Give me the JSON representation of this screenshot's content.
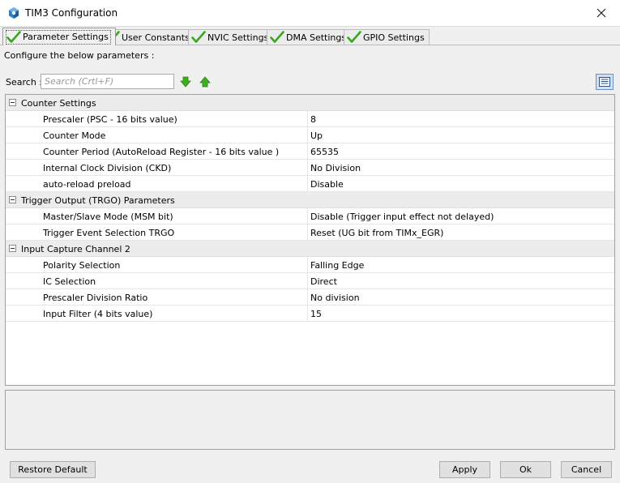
{
  "window": {
    "title": "TIM3 Configuration",
    "close_icon": "close-icon",
    "app_icon": "mx-cube-icon"
  },
  "tabs": [
    {
      "label": "Parameter Settings",
      "active": true,
      "icon": "green-check-icon"
    },
    {
      "label": "User Constants",
      "active": false,
      "icon": "green-check-icon"
    },
    {
      "label": "NVIC Settings",
      "active": false,
      "icon": "green-check-icon"
    },
    {
      "label": "DMA Settings",
      "active": false,
      "icon": "green-check-icon"
    },
    {
      "label": "GPIO Settings",
      "active": false,
      "icon": "green-check-icon"
    }
  ],
  "subtitle": "Configure the below parameters :",
  "search": {
    "label": "Search :",
    "placeholder": "Search (Crtl+F)",
    "value": ""
  },
  "groups": [
    {
      "label": "Counter Settings",
      "params": [
        {
          "name": "Prescaler (PSC - 16 bits value)",
          "value": "8"
        },
        {
          "name": "Counter Mode",
          "value": "Up"
        },
        {
          "name": "Counter Period (AutoReload Register - 16 bits value )",
          "value": "65535"
        },
        {
          "name": "Internal Clock Division (CKD)",
          "value": "No Division"
        },
        {
          "name": "auto-reload preload",
          "value": "Disable"
        }
      ]
    },
    {
      "label": "Trigger Output (TRGO) Parameters",
      "params": [
        {
          "name": "Master/Slave Mode (MSM bit)",
          "value": "Disable (Trigger input effect not delayed)"
        },
        {
          "name": "Trigger Event Selection TRGO",
          "value": "Reset (UG bit from TIMx_EGR)"
        }
      ]
    },
    {
      "label": "Input Capture Channel 2",
      "params": [
        {
          "name": "Polarity Selection",
          "value": "Falling Edge"
        },
        {
          "name": "IC Selection",
          "value": "Direct"
        },
        {
          "name": "Prescaler Division Ratio",
          "value": "No division"
        },
        {
          "name": "Input Filter (4 bits value)",
          "value": "15"
        }
      ]
    }
  ],
  "buttons": {
    "restore_default": "Restore Default",
    "apply": "Apply",
    "ok": "Ok",
    "cancel": "Cancel"
  },
  "colors": {
    "check_green": "#3aa51e",
    "arrow_green": "#3fae1f",
    "group_bg": "#ececec",
    "view_btn_bg": "#cfe0f7"
  }
}
